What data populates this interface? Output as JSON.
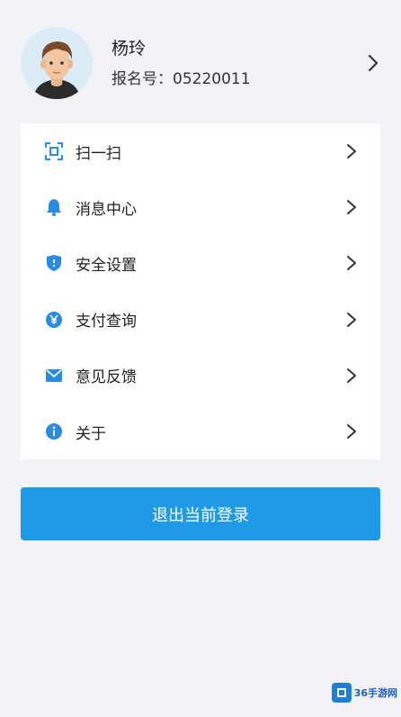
{
  "profile": {
    "name": "杨玲",
    "registration": "报名号：05220011",
    "avatar_icon": "user-avatar-icon"
  },
  "menu": {
    "items": [
      {
        "label": "扫一扫",
        "icon": "scan-icon"
      },
      {
        "label": "消息中心",
        "icon": "bell-icon"
      },
      {
        "label": "安全设置",
        "icon": "shield-icon"
      },
      {
        "label": "支付查询",
        "icon": "yen-coin-icon"
      },
      {
        "label": "意见反馈",
        "icon": "mail-icon"
      },
      {
        "label": "关于",
        "icon": "info-icon"
      }
    ]
  },
  "logout": {
    "label": "退出当前登录"
  },
  "watermark": {
    "text": "36手游网"
  },
  "colors": {
    "accent": "#1e9ae6",
    "background": "#f2f3f7",
    "card": "#ffffff",
    "icon_blue": "#2a8be2"
  }
}
